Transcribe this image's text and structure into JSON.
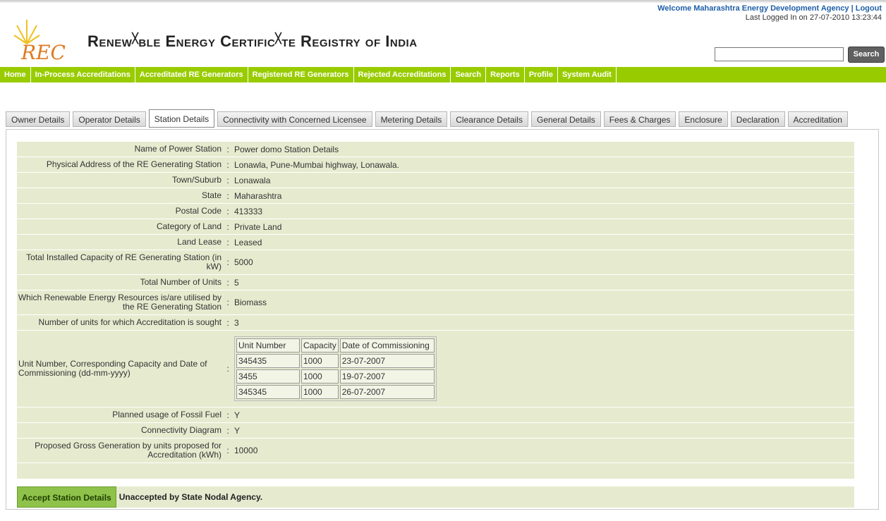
{
  "header": {
    "welcome": "Welcome Maharashtra Energy Development Agency | Logout",
    "last_login": "Last Logged In on 27-07-2010 13:23:44",
    "logo_text": "REC",
    "title_part1": "Renew",
    "title_part2": "ble Energy Certific",
    "title_part3": "te Registry of India",
    "search_value": "",
    "search_button": "Search"
  },
  "nav": [
    "Home",
    "In-Process Accreditations",
    "Accreditated RE Generators",
    "Registered RE Generators",
    "Rejected Accreditations",
    "Search",
    "Reports",
    "Profile",
    "System Audit"
  ],
  "tabs": {
    "active_index": 2,
    "items": [
      "Owner Details",
      "Operator Details",
      "Station Details",
      "Connectivity with Concerned Licensee",
      "Metering Details",
      "Clearance Details",
      "General Details",
      "Fees & Charges",
      "Enclosure",
      "Declaration",
      "Accreditation"
    ]
  },
  "details": {
    "name_label": "Name of Power Station",
    "name_value": "Power domo Station Details",
    "address_label": "Physical Address of the RE Generating Station",
    "address_value": "Lonawla, Pune-Mumbai highway, Lonawala.",
    "town_label": "Town/Suburb",
    "town_value": "Lonawala",
    "state_label": "State",
    "state_value": "Maharashtra",
    "postal_label": "Postal Code",
    "postal_value": "413333",
    "land_cat_label": "Category of Land",
    "land_cat_value": "Private Land",
    "lease_label": "Land Lease",
    "lease_value": "Leased",
    "capacity_label": "Total Installed Capacity of RE Generating Station (in kW)",
    "capacity_value": "5000",
    "units_label": "Total Number of Units",
    "units_value": "5",
    "resources_label": "Which Renewable Energy Resources is/are utilised by the RE Generating Station",
    "resources_value": "Biomass",
    "accr_units_label": "Number of units for which Accreditation is sought",
    "accr_units_value": "3",
    "unit_table_label": "Unit Number, Corresponding Capacity and Date of Commissioning (dd-mm-yyyy)",
    "unit_table_headers": [
      "Unit Number",
      "Capacity",
      "Date of Commissioning"
    ],
    "unit_rows": [
      [
        "345435",
        "1000",
        "23-07-2007"
      ],
      [
        "3455",
        "1000",
        "19-07-2007"
      ],
      [
        "345345",
        "1000",
        "26-07-2007"
      ]
    ],
    "fossil_label": "Planned usage of Fossil Fuel",
    "fossil_value": "Y",
    "diagram_label": "Connectivity Diagram",
    "diagram_value": "Y",
    "gross_label": "Proposed Gross Generation by units proposed for Accreditation (kWh)",
    "gross_value": "10000",
    "colon": ":"
  },
  "footer": {
    "accept_button": "Accept Station Details",
    "status": "Unaccepted by State Nodal Agency."
  },
  "colors": {
    "nav_green": "#99cc00",
    "row_bg": "#e6ebcf",
    "accept_green": "#8fc24a",
    "welcome_blue": "#1f5fa8"
  }
}
